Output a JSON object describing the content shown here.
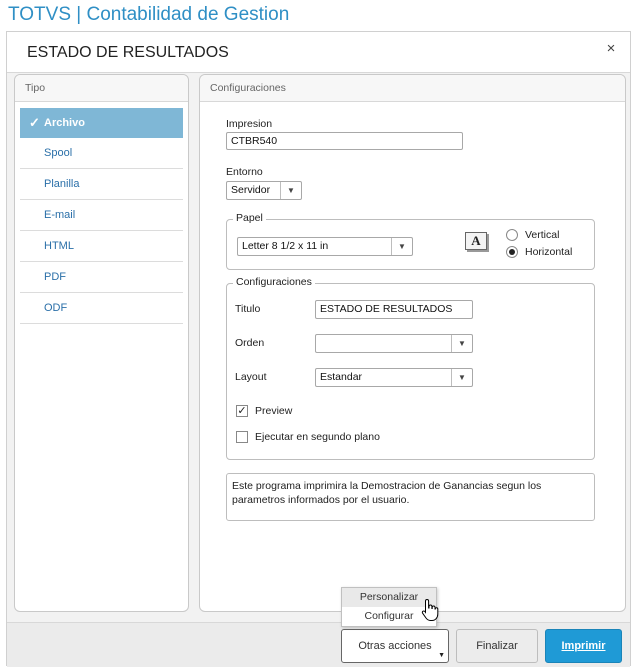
{
  "app": {
    "title": "TOTVS | Contabilidad de Gestion"
  },
  "dialog": {
    "title": "ESTADO DE RESULTADOS",
    "close_symbol": "×"
  },
  "tipo": {
    "header": "Tipo",
    "items": [
      {
        "label": "Archivo",
        "selected": true
      },
      {
        "label": "Spool"
      },
      {
        "label": "Planilla"
      },
      {
        "label": "E-mail"
      },
      {
        "label": "HTML"
      },
      {
        "label": "PDF"
      },
      {
        "label": "ODF"
      }
    ],
    "check_symbol": "✓"
  },
  "config": {
    "header": "Configuraciones",
    "impresion": {
      "label": "Impresion",
      "value": "CTBR540"
    },
    "entorno": {
      "label": "Entorno",
      "value": "Servidor"
    },
    "papel": {
      "title": "Papel",
      "size": "Letter 8 1/2 x 11 in",
      "font_icon_letter": "A",
      "vertical_label": "Vertical",
      "horizontal_label": "Horizontal",
      "orientation": "horizontal"
    },
    "settings": {
      "title": "Configuraciones",
      "titulo": {
        "label": "Titulo",
        "value": "ESTADO DE RESULTADOS"
      },
      "orden": {
        "label": "Orden",
        "value": ""
      },
      "layout": {
        "label": "Layout",
        "value": "Estandar"
      },
      "preview": {
        "label": "Preview",
        "checked": true,
        "check_symbol": "✓"
      },
      "segundo_plano": {
        "label": "Ejecutar en segundo plano",
        "checked": false
      }
    },
    "description": "Este programa imprimira la Demostracion de Ganancias segun los parametros informados por el usuario."
  },
  "footer": {
    "otras_acciones": "Otras acciones",
    "finalizar": "Finalizar",
    "imprimir": "Imprimir",
    "dropdown_caret": "▼"
  },
  "popup_menu": {
    "items": [
      {
        "label": "Personalizar",
        "hover": true
      },
      {
        "label": "Configurar"
      }
    ]
  },
  "select_arrow": "▼",
  "colors": {
    "accent": "#2f8fc5",
    "selected_item": "#7fb7d6",
    "primary_button": "#1f9ad6",
    "link": "#2a6fa8"
  }
}
